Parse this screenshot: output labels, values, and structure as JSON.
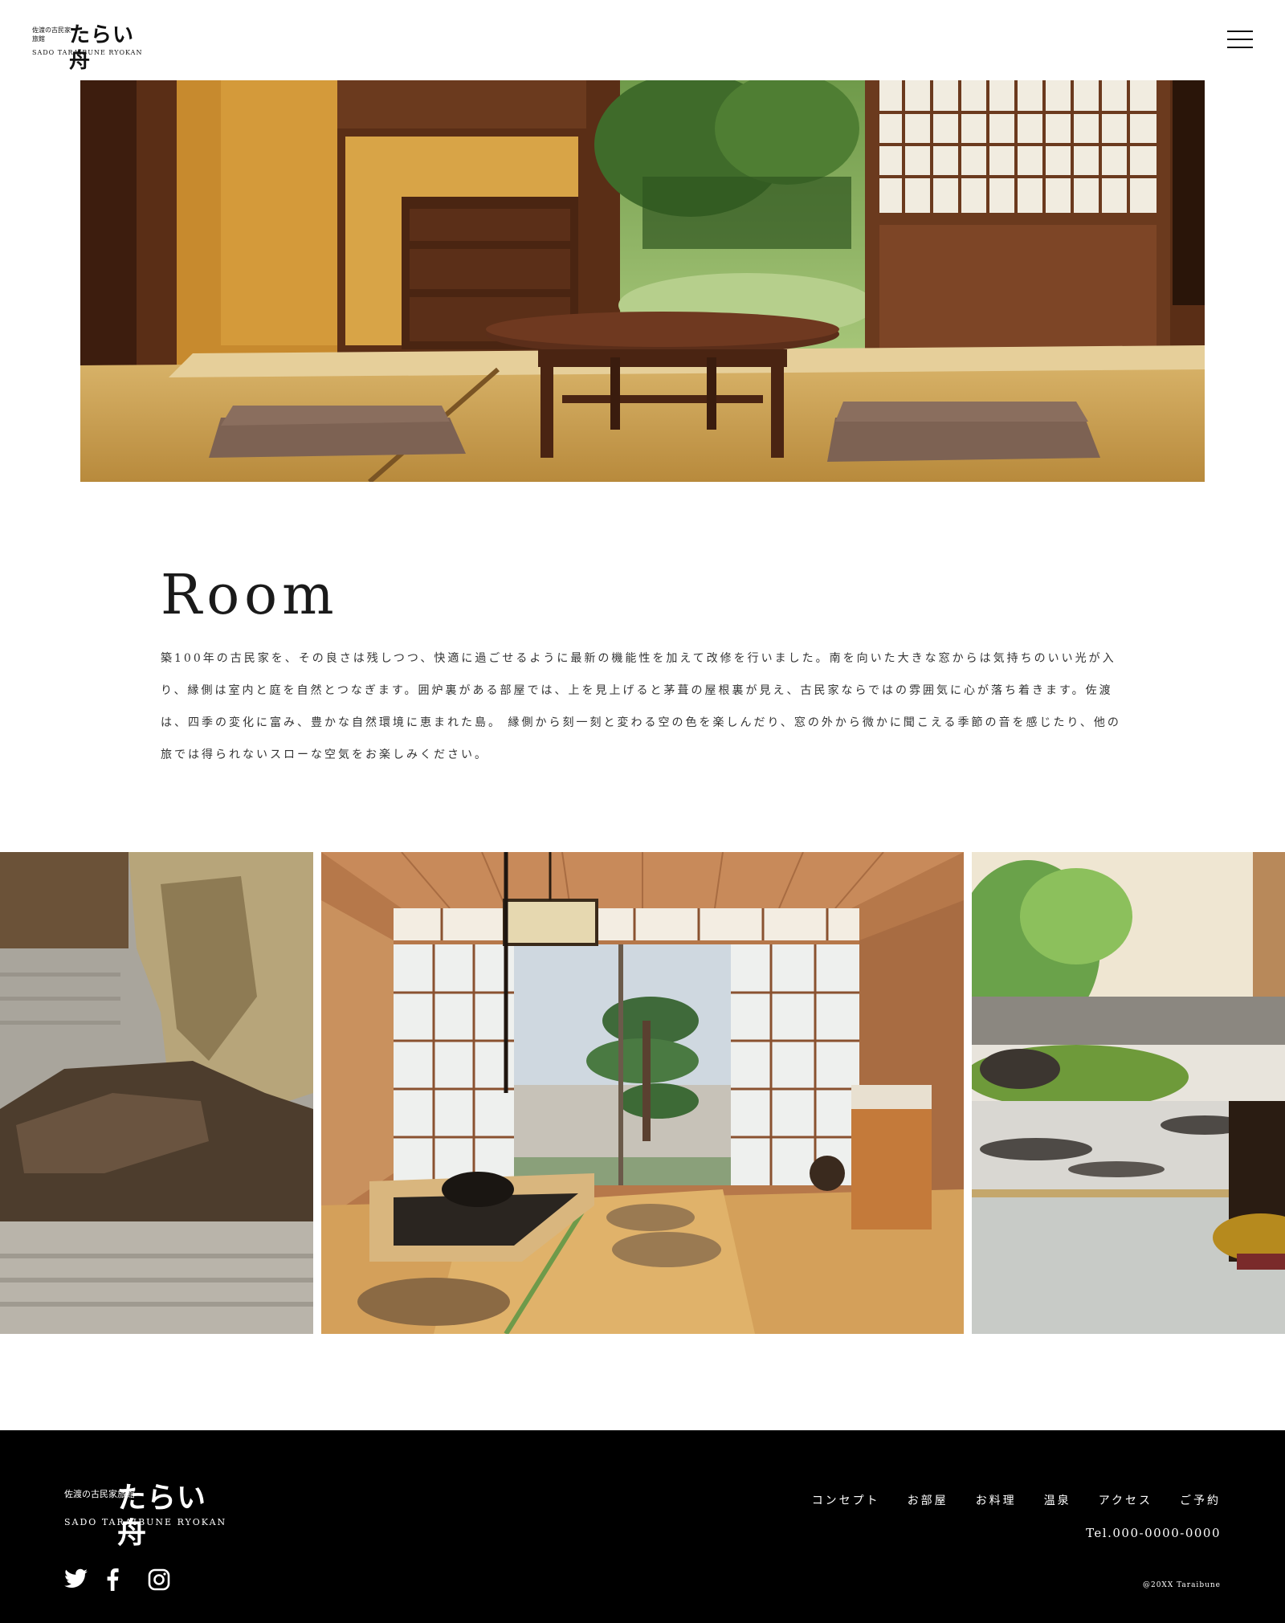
{
  "header": {
    "logo": {
      "small_text": "佐渡の古民家旅館",
      "main_text": "たらい舟",
      "roman_text": "SADO TARAIBUNE RYOKAN"
    },
    "menu_icon": "hamburger-icon"
  },
  "room": {
    "title": "Room",
    "paragraph": "築100年の古民家を、その良さは残しつつ、快適に過ごせるように最新の機能性を加えて改修を行いました。南を向いた大きな窓からは気持ちのいい光が入り、縁側は室内と庭を自然とつなぎます。囲炉裏がある部屋では、上を見上げると茅葺の屋根裏が見え、古民家ならではの雰囲気に心が落ち着きます。佐渡は、四季の変化に富み、豊かな自然環境に恵まれた島。 縁側から刻一刻と変わる空の色を楽しんだり、窓の外から微かに聞こえる季節の音を感じたり、他の旅では得られないスローな空気をお楽しみください。"
  },
  "footer": {
    "logo": {
      "small_text": "佐渡の古民家旅館",
      "main_text": "たらい舟",
      "roman_text": "SADO TARAIBUNE RYOKAN"
    },
    "nav": [
      {
        "label": "コンセプト"
      },
      {
        "label": "お部屋"
      },
      {
        "label": "お料理"
      },
      {
        "label": "温泉"
      },
      {
        "label": "アクセス"
      },
      {
        "label": "ご予約"
      }
    ],
    "tel": "Tel.000-0000-0000",
    "social_icons": [
      "twitter-icon",
      "facebook-icon",
      "instagram-icon"
    ],
    "copyright": "@20XX Taraibune"
  },
  "colors": {
    "footer_bg": "#000000",
    "text": "#222222",
    "tatami": "#c9a25a",
    "wood": "#6b3a1e"
  }
}
